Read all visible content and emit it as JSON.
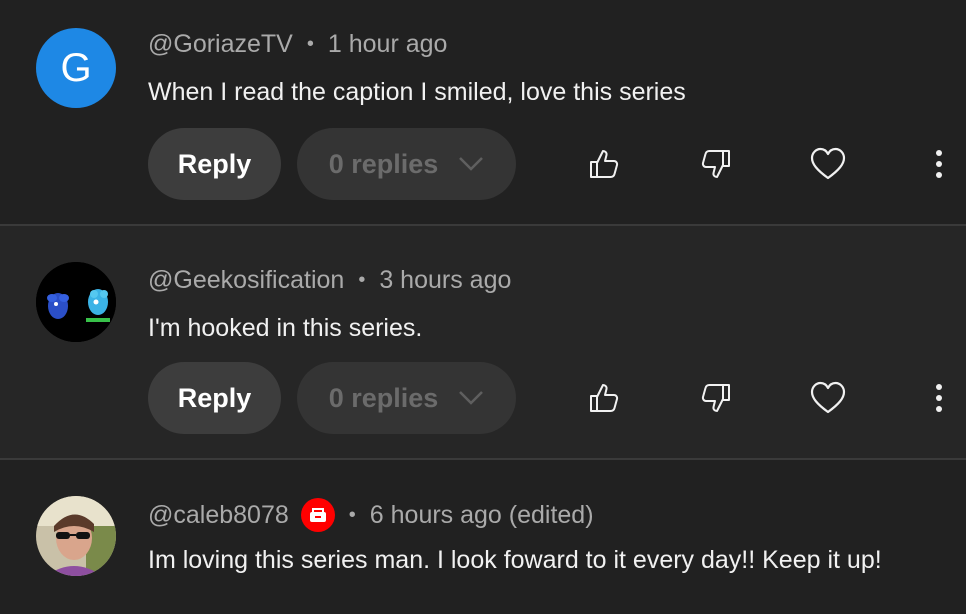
{
  "comments": [
    {
      "avatar_letter": "G",
      "author": "@GoriazeTV",
      "separator": "•",
      "time": "1 hour ago",
      "text": "When I read the caption I smiled, love this series",
      "reply_label": "Reply",
      "replies_label": "0 replies"
    },
    {
      "author": "@Geekosification",
      "separator": "•",
      "time": "3 hours ago",
      "text": "I'm hooked in this series.",
      "reply_label": "Reply",
      "replies_label": "0 replies"
    },
    {
      "author": "@caleb8078",
      "separator": "•",
      "time": "6 hours ago (edited)",
      "text": "Im loving this series man. I look foward to it every day!! Keep it up!"
    }
  ],
  "colors": {
    "background": "#212121",
    "avatar_blue": "#1e88e5",
    "badge_red": "#ff0000",
    "button_bg": "#3d3d3d",
    "muted_text": "#aaaaaa"
  },
  "icons": [
    "thumbs-up-icon",
    "thumbs-down-icon",
    "heart-icon",
    "more-vertical-icon",
    "chevron-down-icon",
    "creator-badge-icon"
  ]
}
